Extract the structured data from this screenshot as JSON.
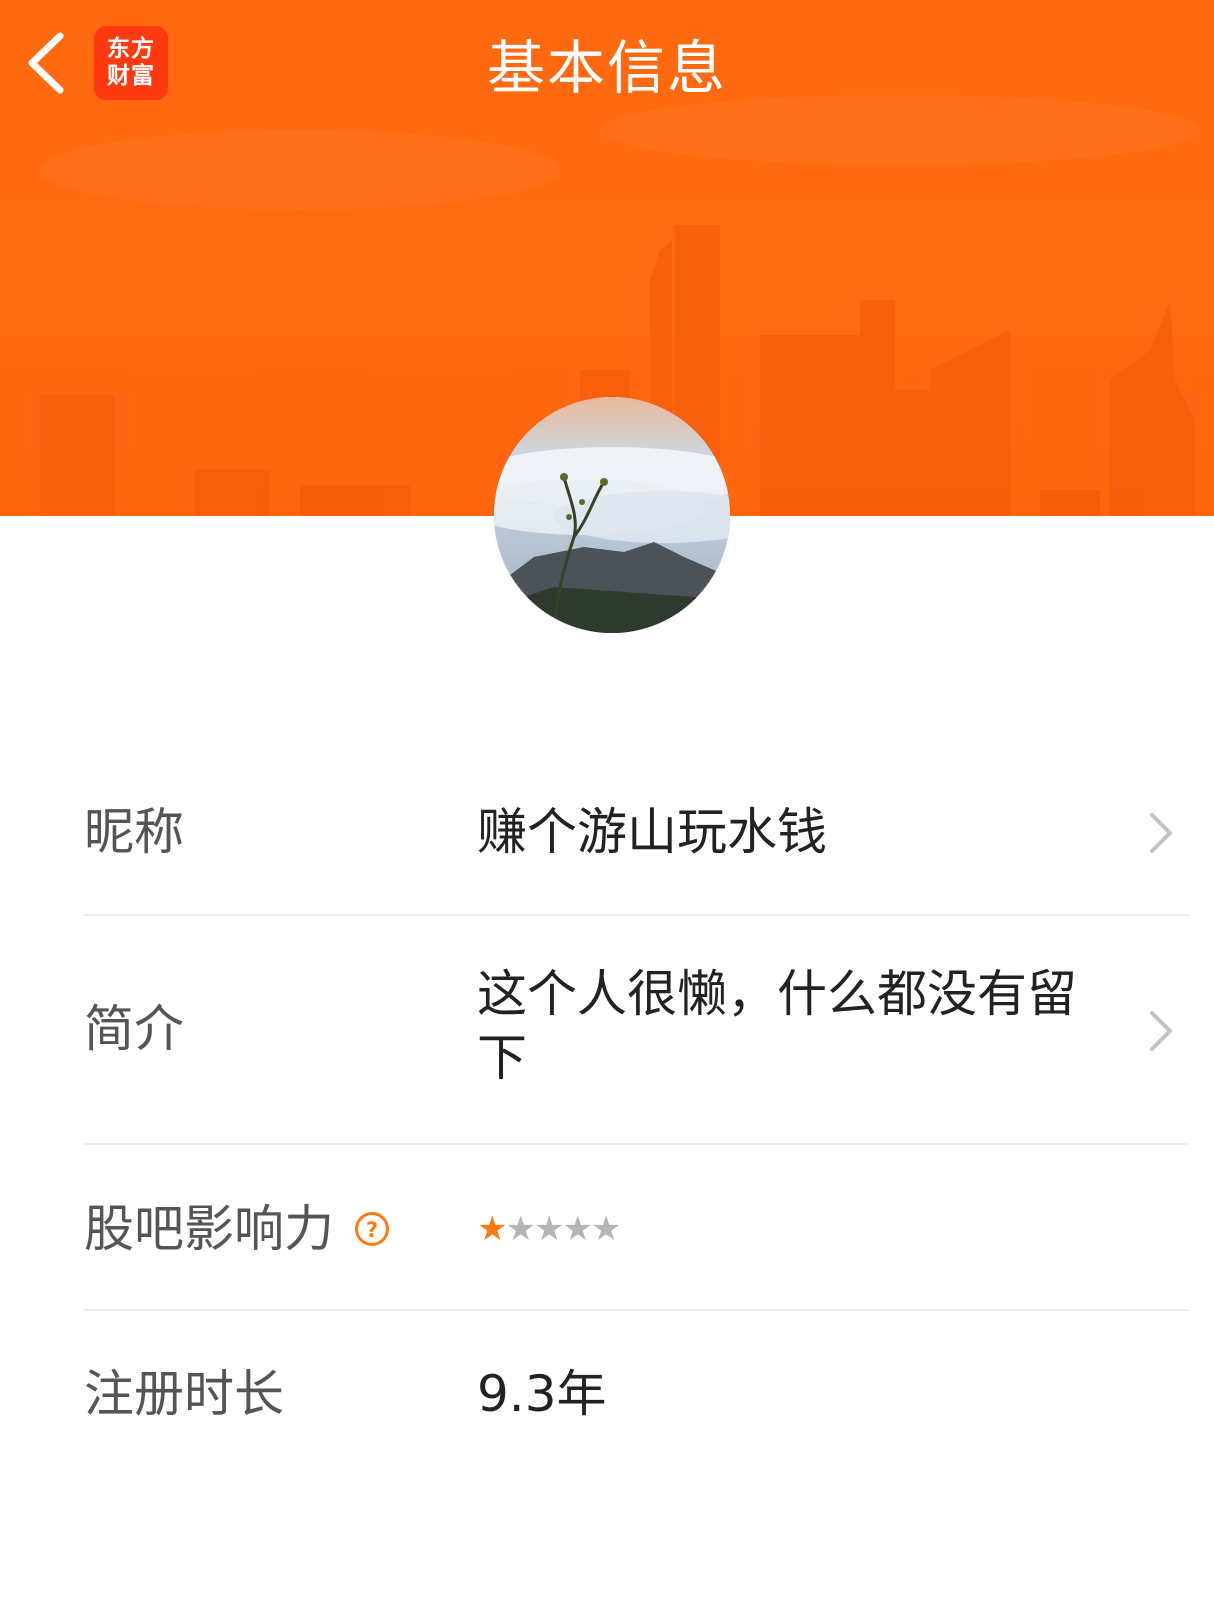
{
  "header": {
    "title": "基本信息",
    "back_icon": "chevron-left-icon",
    "logo": {
      "line1": "东方",
      "line2": "财富"
    },
    "accent_color": "#ff6a10"
  },
  "profile": {
    "avatar_desc": "avatar"
  },
  "rows": [
    {
      "label": "昵称",
      "value": "赚个游山玩水钱",
      "has_arrow": true
    },
    {
      "label": "简介",
      "value": "这个人很懒，什么都没有留下",
      "has_arrow": true
    },
    {
      "label": "股吧影响力",
      "help_icon": "question-circle-icon",
      "rating": 1,
      "rating_max": 5,
      "star_on": "★",
      "star_off": "★★★★"
    },
    {
      "label": "注册时长",
      "value": "9.3年",
      "has_arrow": false
    }
  ]
}
